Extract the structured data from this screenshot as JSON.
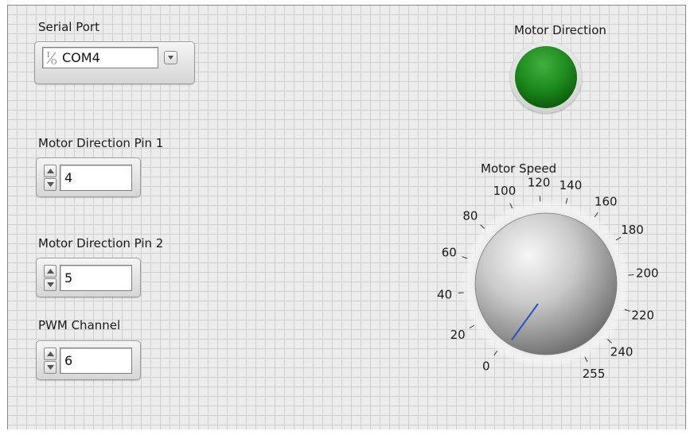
{
  "serial_port": {
    "label": "Serial Port",
    "value": "COM4",
    "io_glyph_top": "I",
    "io_glyph_bottom": "O"
  },
  "motor_direction_pin_1": {
    "label": "Motor Direction Pin 1",
    "value": "4"
  },
  "motor_direction_pin_2": {
    "label": "Motor Direction Pin 2",
    "value": "5"
  },
  "pwm_channel": {
    "label": "PWM Channel",
    "value": "6"
  },
  "motor_direction": {
    "label": "Motor Direction",
    "led_state": "on",
    "led_color": "#1d8a1d"
  },
  "motor_speed": {
    "label": "Motor Speed",
    "value": 0,
    "min": 0,
    "max": 255,
    "scale_labels": [
      "0",
      "20",
      "40",
      "60",
      "80",
      "100",
      "120",
      "140",
      "160",
      "180",
      "200",
      "220",
      "240",
      "255"
    ],
    "needle_color": "#2a4fc8"
  }
}
